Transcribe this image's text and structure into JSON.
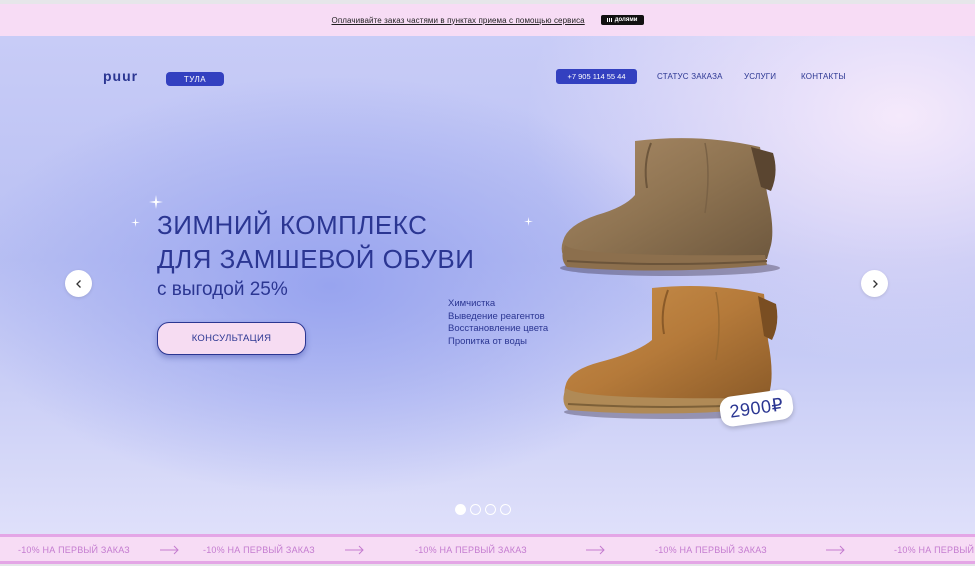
{
  "promo": {
    "text": "Оплачивайте заказ частями в пунктах приема с помощью сервиса",
    "badge": "долями"
  },
  "header": {
    "logo": "puur",
    "city": "ТУЛА",
    "phone": "+7 905 114 55 44",
    "nav": [
      "СТАТУС ЗАКАЗА",
      "УСЛУГИ",
      "КОНТАКТЫ"
    ]
  },
  "hero": {
    "title_line1": "ЗИМНИЙ КОМПЛЕКС",
    "title_line2": "ДЛЯ ЗАМШЕВОЙ ОБУВИ",
    "subtitle": "с выгодой 25%",
    "button": "КОНСУЛЬТАЦИЯ",
    "services": [
      "Химчистка",
      "Выведение реагентов",
      "Восстановление цвета",
      "Пропитка от воды"
    ],
    "price": "2900₽"
  },
  "slider": {
    "slides": 4,
    "active": 1
  },
  "marquee": {
    "text": "-10% НА ПЕРВЫЙ ЗАКАЗ"
  },
  "colors": {
    "brand": "#2b3692",
    "button": "#3340c0",
    "pink": "#f7dcf5",
    "marquee_text": "#c47cd0"
  },
  "icons": {
    "prev": "chevron-left-icon",
    "next": "chevron-right-icon",
    "sparkle": "sparkle-icon",
    "marquee_arrow": "arrow-right-icon"
  }
}
